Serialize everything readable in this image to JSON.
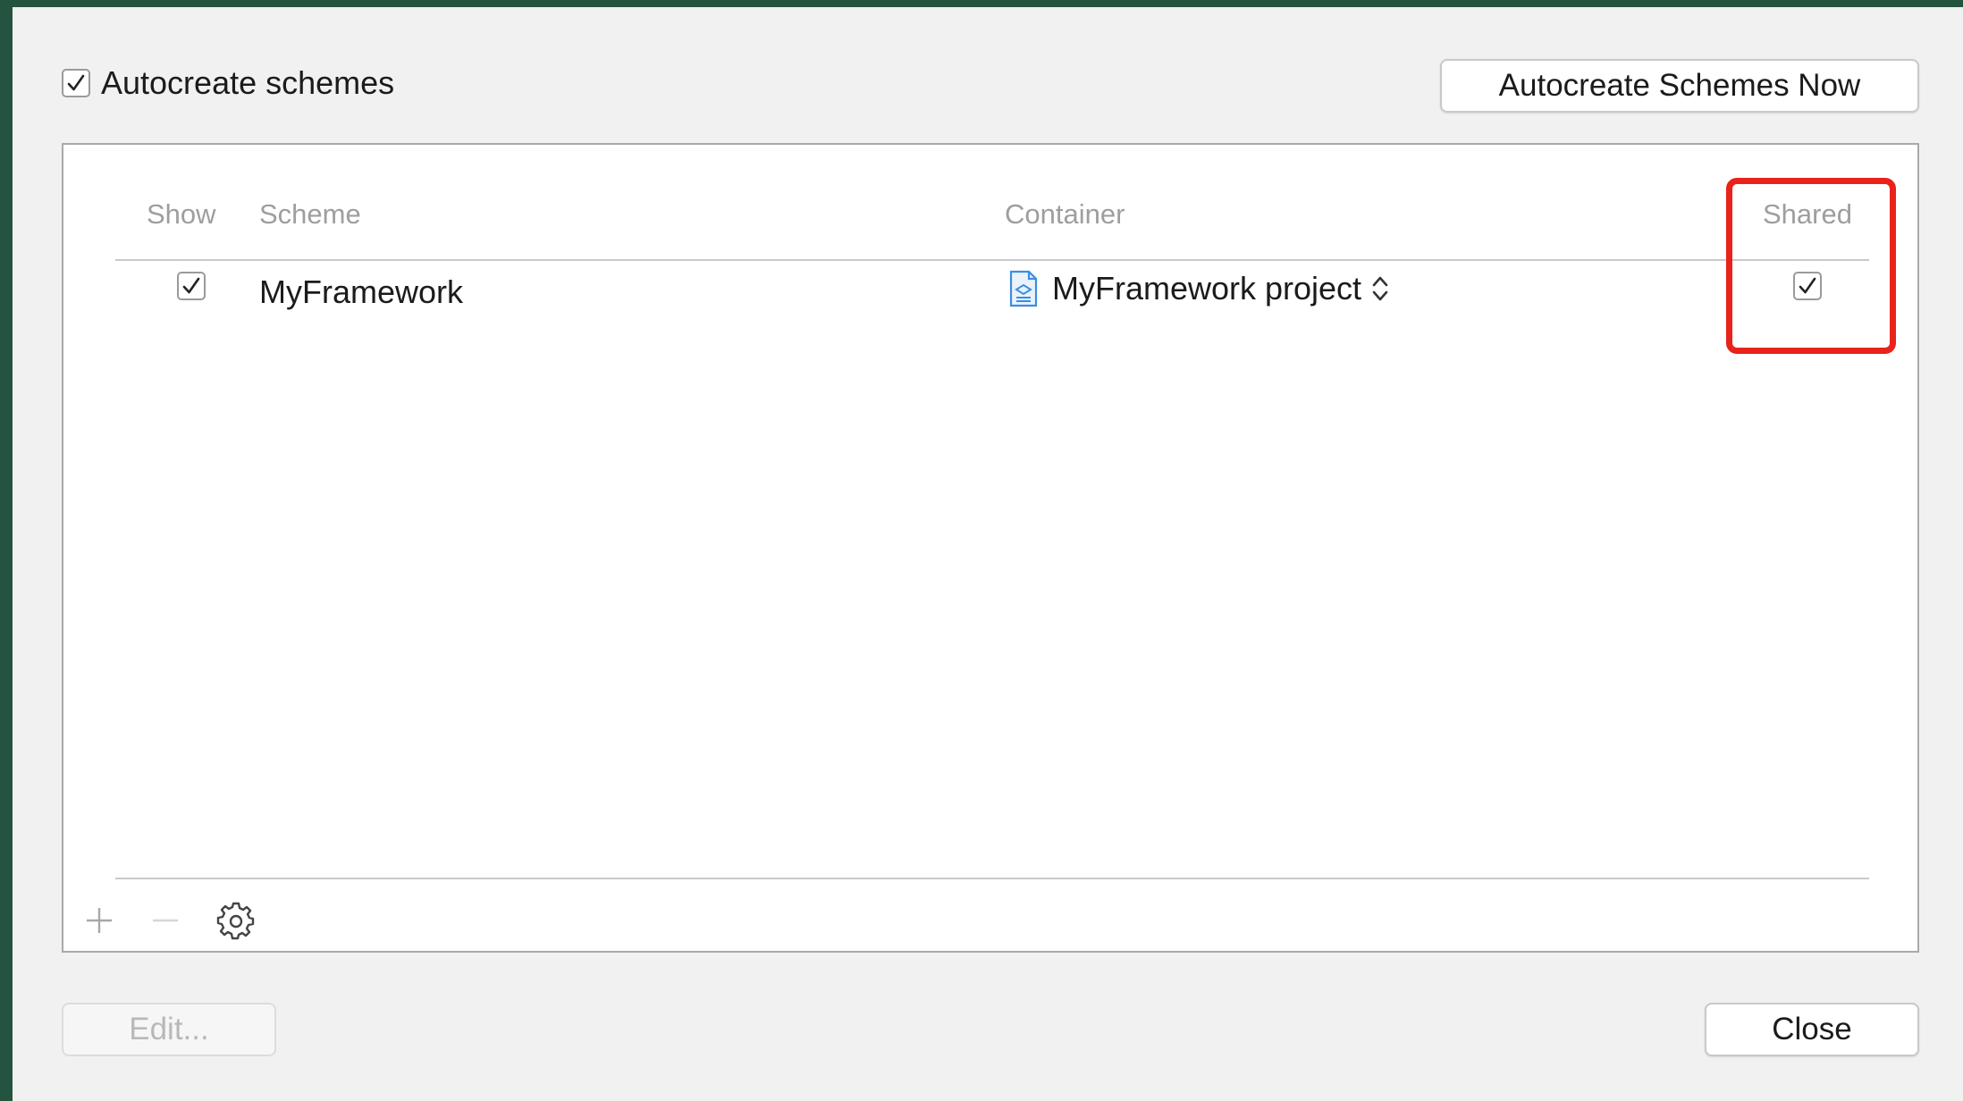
{
  "top": {
    "autocreate_label": "Autocreate schemes",
    "autocreate_checked": true,
    "autocreate_now_label": "Autocreate Schemes Now"
  },
  "table": {
    "columns": [
      "Show",
      "Scheme",
      "Container",
      "Shared"
    ],
    "rows": [
      {
        "show": true,
        "scheme": "MyFramework",
        "container": "MyFramework project",
        "shared": true
      }
    ]
  },
  "toolbar": {
    "add_icon": "plus-icon",
    "remove_icon": "minus-icon",
    "actions_icon": "gear-icon"
  },
  "footer": {
    "edit_label": "Edit...",
    "close_label": "Close"
  },
  "colors": {
    "highlight": "#e8231a",
    "background": "#245440"
  }
}
